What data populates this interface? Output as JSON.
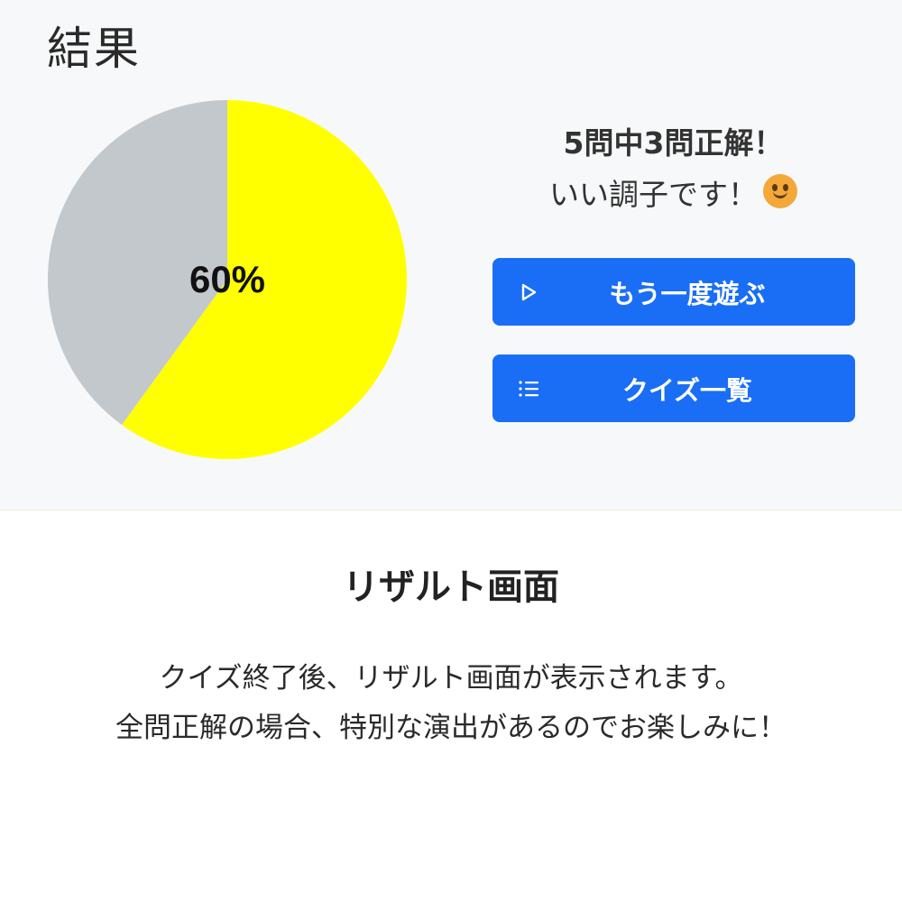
{
  "header": {
    "title": "結果"
  },
  "chart_data": {
    "type": "pie",
    "values": [
      60,
      40
    ],
    "colors": [
      "#ffff00",
      "#c3c8cd"
    ],
    "center_label": "60%"
  },
  "summary": {
    "score_text": "5問中3問正解！",
    "message": "いい調子です！",
    "emoji_icon": "smiley-face-icon"
  },
  "buttons": {
    "replay": {
      "label": "もう一度遊ぶ",
      "icon": "play-icon"
    },
    "list": {
      "label": "クイズ一覧",
      "icon": "list-icon"
    }
  },
  "caption": {
    "title": "リザルト画面",
    "line1": "クイズ終了後、リザルト画面が表示されます。",
    "line2": "全問正解の場合、特別な演出があるのでお楽しみに！"
  },
  "colors": {
    "accent": "#1a6ef5",
    "pie_correct": "#ffff00",
    "pie_remaining": "#c3c8cd"
  }
}
